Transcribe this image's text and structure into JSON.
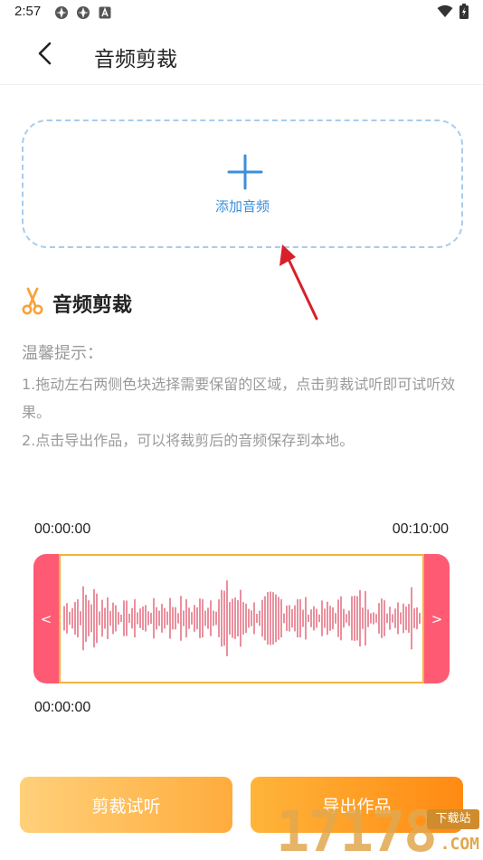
{
  "status_bar": {
    "time": "2:57",
    "icons": [
      "app-notification-icon",
      "app-notification-icon",
      "text-notification-icon",
      "wifi-icon",
      "battery-icon"
    ]
  },
  "header": {
    "title": "音频剪裁",
    "back_icon": "chevron-left-icon"
  },
  "add_audio": {
    "label": "添加音频",
    "icon": "plus-icon"
  },
  "section": {
    "title": "音频剪裁",
    "icon": "scissors-icon"
  },
  "tips": {
    "title": "温馨提示：",
    "body": "1.拖动左右两侧色块选择需要保留的区域，点击剪裁试听即可试听效果。\n2.点击导出作品，可以将裁剪后的音频保存到本地。"
  },
  "editor": {
    "start_time": "00:00:00",
    "end_time": "00:10:00",
    "current_time": "00:00:00",
    "left_handle": "<",
    "right_handle": ">"
  },
  "actions": {
    "trial_label": "剪裁试听",
    "export_label": "导出作品"
  },
  "watermark": {
    "digits": "17178",
    "tag": "下载站",
    "domain": ".COM"
  },
  "colors": {
    "accent_blue": "#3a8fdc",
    "handle_pink": "#ff5a73",
    "wave_red": "#d8354f",
    "border_orange": "#f6b23c",
    "button_orange": "#ff8a12"
  }
}
